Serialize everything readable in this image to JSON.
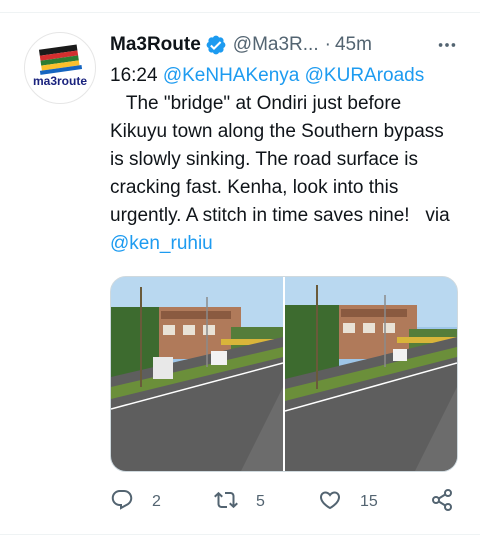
{
  "tweet": {
    "author_name": "Ma3Route",
    "handle": "@Ma3R...",
    "separator": "·",
    "timestamp": "45m",
    "text_prefix": "16:24 ",
    "mention_1": "@KeNHAKenya",
    "space_1": " ",
    "mention_2": "@KURAroads",
    "body": "\n   The \"bridge\" at Ondiri just before Kikuyu town along the Southern bypass is slowly sinking. The road surface is cracking fast. Kenha, look into this urgently. A stitch in time saves nine!   via ",
    "mention_3": "@ken_ruhiu",
    "avatar_logo_text": "ma3route"
  },
  "actions": {
    "reply_count": "2",
    "retweet_count": "5",
    "like_count": "15"
  },
  "icons": {
    "verified": "verified-badge-icon",
    "more": "more-horizontal-icon",
    "reply": "reply-icon",
    "retweet": "retweet-icon",
    "like": "heart-icon",
    "share": "share-icon"
  },
  "colors": {
    "accent": "#1d9bf0",
    "secondary_text": "#536471",
    "primary_text": "#0f1419",
    "border": "#cfd9de"
  }
}
